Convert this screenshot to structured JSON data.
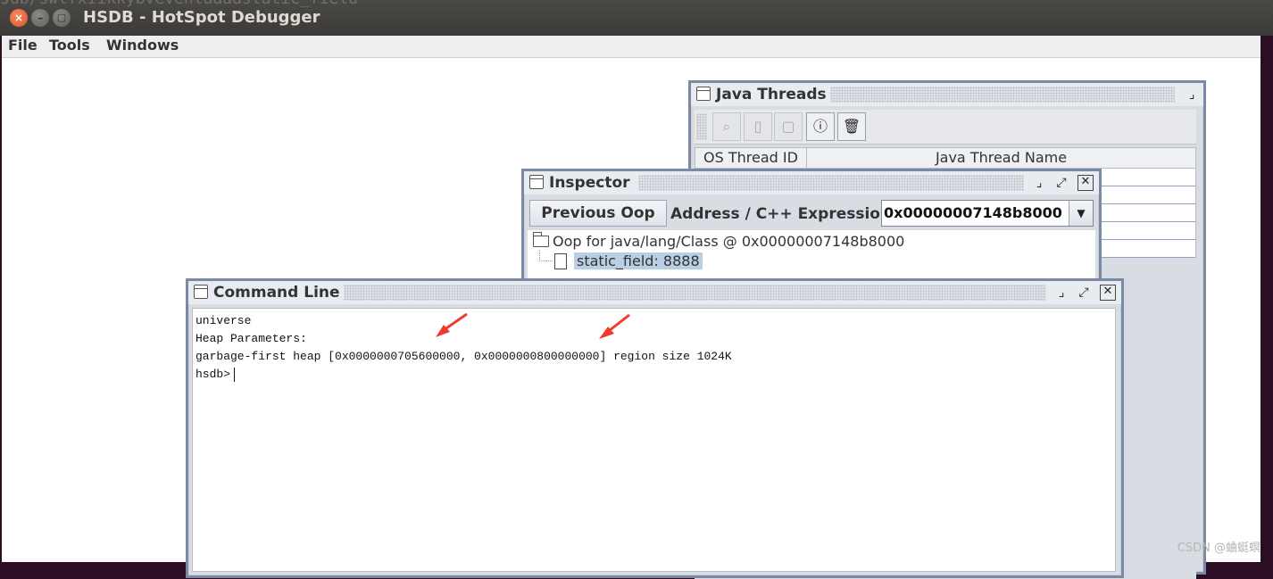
{
  "os_titlebar": {
    "ghost_text": "sub/swtfxiikkybveventaaaastatic_field",
    "app_title": "HSDB - HotSpot Debugger",
    "close_glyph": "×",
    "minimize_glyph": "–",
    "maximize_glyph": "▢"
  },
  "menubar": {
    "items": [
      {
        "label": "File"
      },
      {
        "label": "Tools"
      },
      {
        "label": "Windows"
      }
    ]
  },
  "java_threads": {
    "title": "Java Threads",
    "columns": [
      "OS Thread ID",
      "Java Thread Name"
    ],
    "toolbar_icons": [
      "magnifier-icon",
      "stop-icon",
      "stack-icon",
      "info-icon",
      "trash-icon"
    ]
  },
  "inspector": {
    "title": "Inspector",
    "previous_button": "Previous Oop",
    "address_label": "Address / C++ Expression:",
    "address_value": "0x00000007148b8000",
    "tree_root": "Oop for java/lang/Class @ 0x00000007148b8000",
    "tree_child": "static_field: 8888"
  },
  "command_line": {
    "title": "Command Line",
    "lines": [
      "universe",
      "Heap Parameters:",
      "garbage-first heap [0x0000000705600000, 0x0000000800000000] region size 1024K"
    ],
    "prompt": "hsdb>"
  },
  "titlebar_controls": {
    "iconify": "⌟",
    "maximize": "⤢",
    "close": "✕"
  },
  "annotation_color": "#f03a2e",
  "watermark": "CSDN @蛐蜓螟"
}
